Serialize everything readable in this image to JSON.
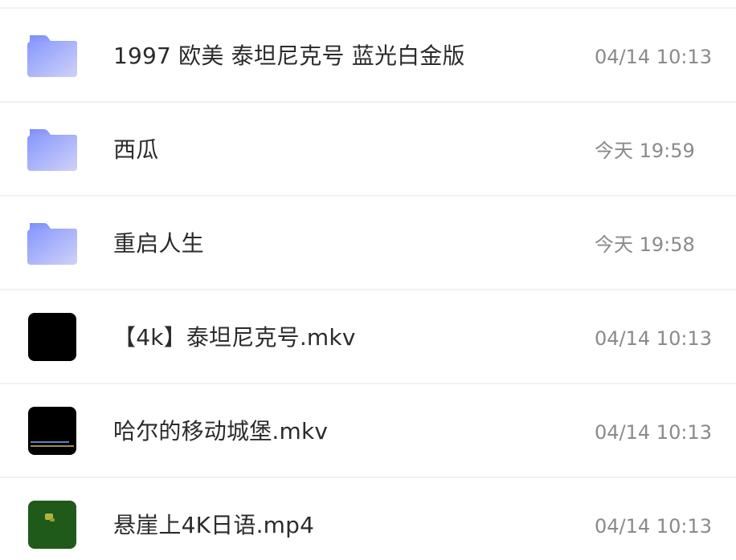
{
  "files": [
    {
      "type": "folder",
      "name": "1997 欧美 泰坦尼克号 蓝光白金版",
      "date": "04/14 10:13"
    },
    {
      "type": "folder",
      "name": "西瓜",
      "date": "今天 19:59"
    },
    {
      "type": "folder",
      "name": "重启人生",
      "date": "今天 19:58"
    },
    {
      "type": "video",
      "name": "【4k】泰坦尼克号.mkv",
      "date": "04/14 10:13"
    },
    {
      "type": "video",
      "name": "哈尔的移动城堡.mkv",
      "date": "04/14 10:13"
    },
    {
      "type": "video",
      "name": "悬崖上4K日语.mp4",
      "date": "04/14 10:13"
    }
  ],
  "colors": {
    "folder_gradient_start": "#8c9cff",
    "folder_gradient_end": "#c9cdf7",
    "name_text": "#2b2b2b",
    "date_text": "#8a8a8a",
    "separator": "#f1f1f3"
  },
  "icons": {
    "folder": "folder-icon",
    "video": "video-thumbnail"
  }
}
